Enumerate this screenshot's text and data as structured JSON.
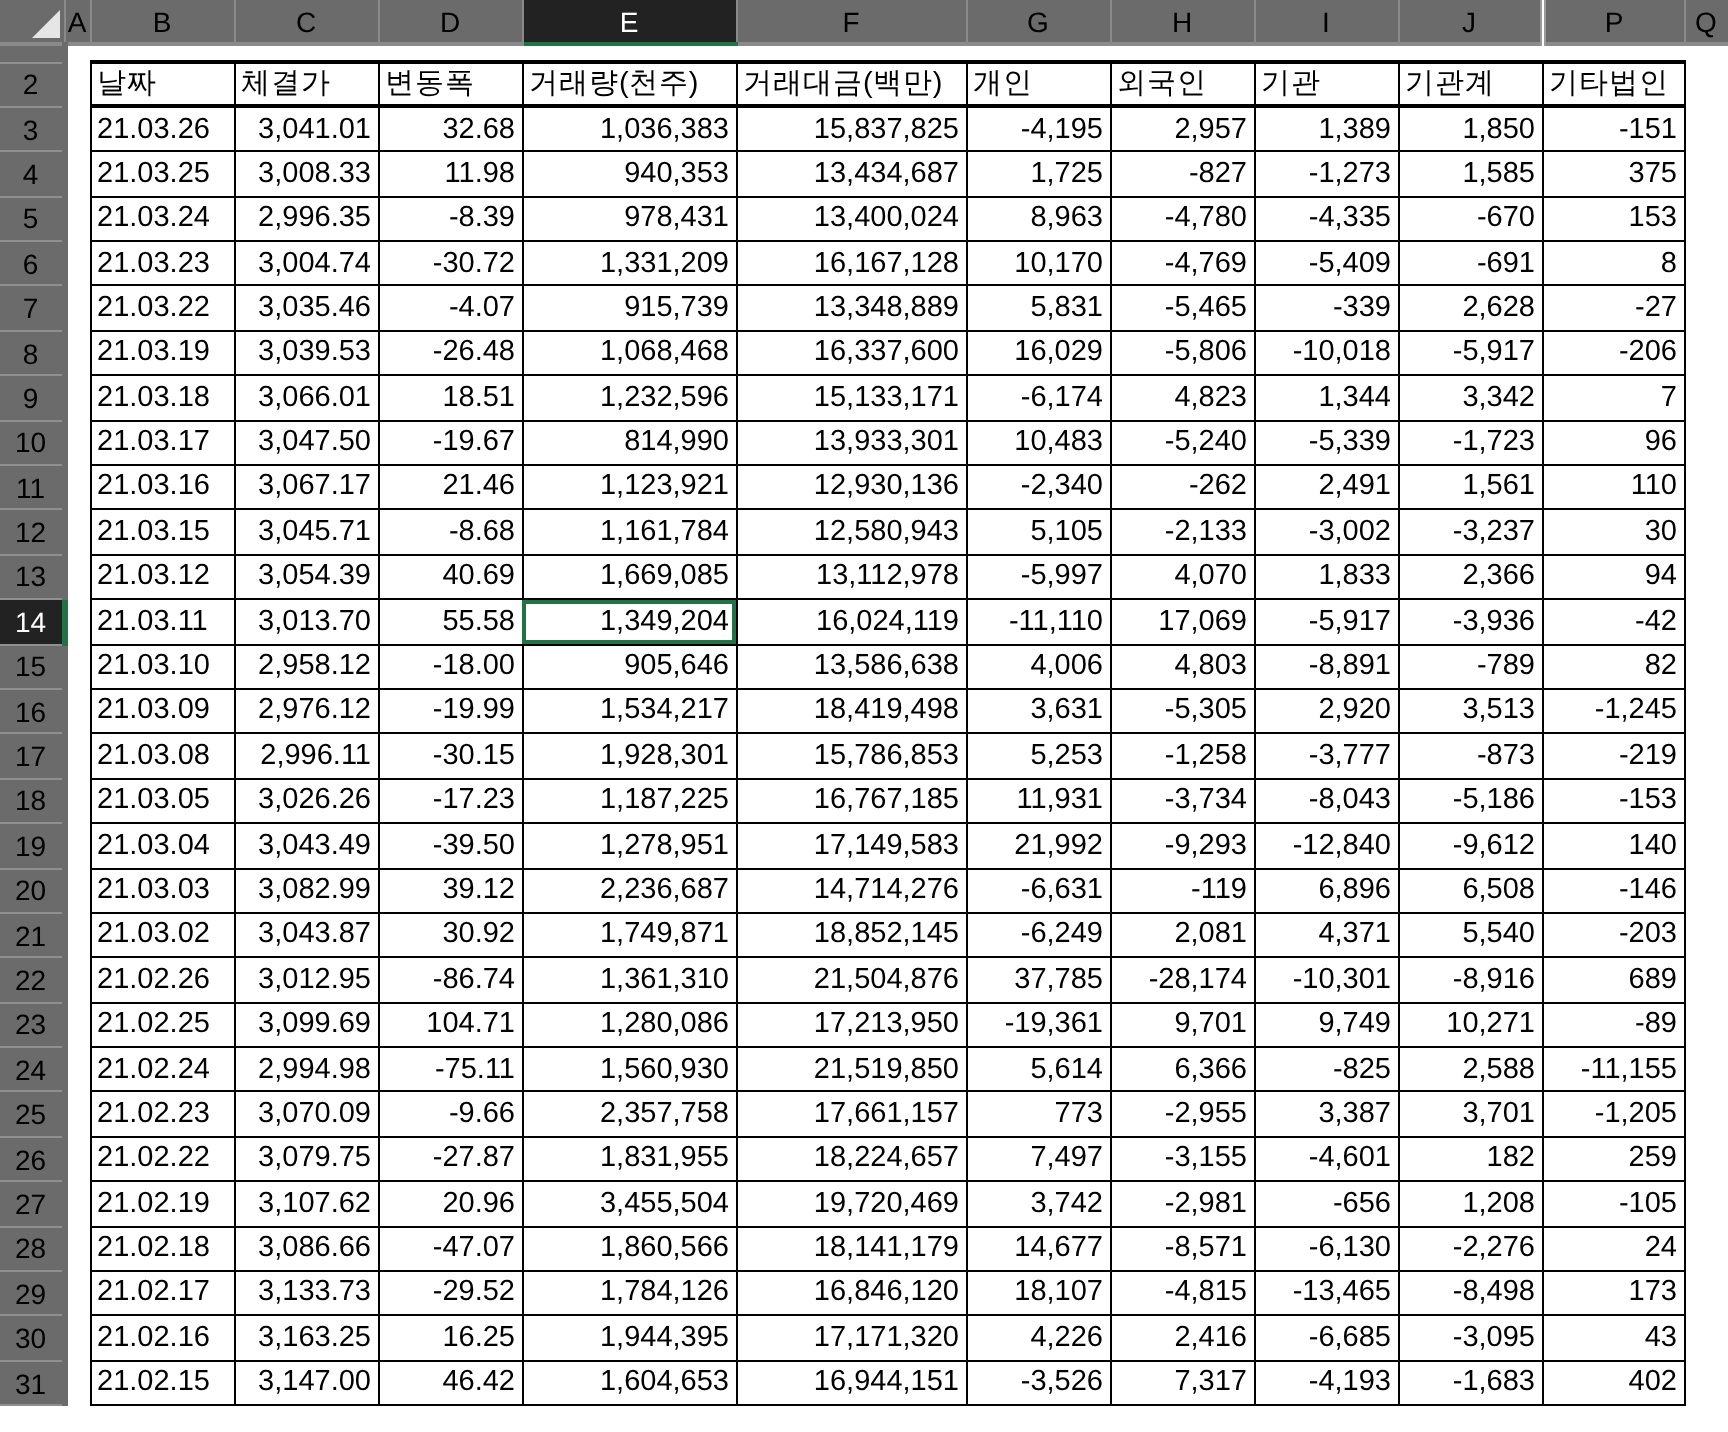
{
  "column_headers": [
    {
      "label": "A",
      "kind": "empty",
      "selected": false
    },
    {
      "label": "B",
      "kind": "data",
      "selected": false
    },
    {
      "label": "C",
      "kind": "data",
      "selected": false
    },
    {
      "label": "D",
      "kind": "data",
      "selected": false
    },
    {
      "label": "E",
      "kind": "data",
      "selected": true
    },
    {
      "label": "F",
      "kind": "data",
      "selected": false
    },
    {
      "label": "G",
      "kind": "data",
      "selected": false
    },
    {
      "label": "H",
      "kind": "data",
      "selected": false
    },
    {
      "label": "I",
      "kind": "data",
      "selected": false
    },
    {
      "label": "J",
      "kind": "data",
      "selected": false
    },
    {
      "label": "P",
      "kind": "data",
      "selected": false
    },
    {
      "label": "Q",
      "kind": "empty",
      "selected": false
    }
  ],
  "header_row": {
    "row_number": "2",
    "selected": false,
    "cells": [
      "날짜",
      "체결가",
      "변동폭",
      "거래량(천주)",
      "거래대금(백만)",
      "개인",
      "외국인",
      "기관",
      "기관계",
      "기타법인"
    ]
  },
  "rows": [
    {
      "row_number": "3",
      "selected": false,
      "cells": [
        "21.03.26",
        "3,041.01",
        "32.68",
        "1,036,383",
        "15,837,825",
        "-4,195",
        "2,957",
        "1,389",
        "1,850",
        "-151"
      ]
    },
    {
      "row_number": "4",
      "selected": false,
      "cells": [
        "21.03.25",
        "3,008.33",
        "11.98",
        "940,353",
        "13,434,687",
        "1,725",
        "-827",
        "-1,273",
        "1,585",
        "375"
      ]
    },
    {
      "row_number": "5",
      "selected": false,
      "cells": [
        "21.03.24",
        "2,996.35",
        "-8.39",
        "978,431",
        "13,400,024",
        "8,963",
        "-4,780",
        "-4,335",
        "-670",
        "153"
      ]
    },
    {
      "row_number": "6",
      "selected": false,
      "cells": [
        "21.03.23",
        "3,004.74",
        "-30.72",
        "1,331,209",
        "16,167,128",
        "10,170",
        "-4,769",
        "-5,409",
        "-691",
        "8"
      ]
    },
    {
      "row_number": "7",
      "selected": false,
      "cells": [
        "21.03.22",
        "3,035.46",
        "-4.07",
        "915,739",
        "13,348,889",
        "5,831",
        "-5,465",
        "-339",
        "2,628",
        "-27"
      ]
    },
    {
      "row_number": "8",
      "selected": false,
      "cells": [
        "21.03.19",
        "3,039.53",
        "-26.48",
        "1,068,468",
        "16,337,600",
        "16,029",
        "-5,806",
        "-10,018",
        "-5,917",
        "-206"
      ]
    },
    {
      "row_number": "9",
      "selected": false,
      "cells": [
        "21.03.18",
        "3,066.01",
        "18.51",
        "1,232,596",
        "15,133,171",
        "-6,174",
        "4,823",
        "1,344",
        "3,342",
        "7"
      ]
    },
    {
      "row_number": "10",
      "selected": false,
      "cells": [
        "21.03.17",
        "3,047.50",
        "-19.67",
        "814,990",
        "13,933,301",
        "10,483",
        "-5,240",
        "-5,339",
        "-1,723",
        "96"
      ]
    },
    {
      "row_number": "11",
      "selected": false,
      "cells": [
        "21.03.16",
        "3,067.17",
        "21.46",
        "1,123,921",
        "12,930,136",
        "-2,340",
        "-262",
        "2,491",
        "1,561",
        "110"
      ]
    },
    {
      "row_number": "12",
      "selected": false,
      "cells": [
        "21.03.15",
        "3,045.71",
        "-8.68",
        "1,161,784",
        "12,580,943",
        "5,105",
        "-2,133",
        "-3,002",
        "-3,237",
        "30"
      ]
    },
    {
      "row_number": "13",
      "selected": false,
      "cells": [
        "21.03.12",
        "3,054.39",
        "40.69",
        "1,669,085",
        "13,112,978",
        "-5,997",
        "4,070",
        "1,833",
        "2,366",
        "94"
      ]
    },
    {
      "row_number": "14",
      "selected": true,
      "cells": [
        "21.03.11",
        "3,013.70",
        "55.58",
        "1,349,204",
        "16,024,119",
        "-11,110",
        "17,069",
        "-5,917",
        "-3,936",
        "-42"
      ]
    },
    {
      "row_number": "15",
      "selected": false,
      "cells": [
        "21.03.10",
        "2,958.12",
        "-18.00",
        "905,646",
        "13,586,638",
        "4,006",
        "4,803",
        "-8,891",
        "-789",
        "82"
      ]
    },
    {
      "row_number": "16",
      "selected": false,
      "cells": [
        "21.03.09",
        "2,976.12",
        "-19.99",
        "1,534,217",
        "18,419,498",
        "3,631",
        "-5,305",
        "2,920",
        "3,513",
        "-1,245"
      ]
    },
    {
      "row_number": "17",
      "selected": false,
      "cells": [
        "21.03.08",
        "2,996.11",
        "-30.15",
        "1,928,301",
        "15,786,853",
        "5,253",
        "-1,258",
        "-3,777",
        "-873",
        "-219"
      ]
    },
    {
      "row_number": "18",
      "selected": false,
      "cells": [
        "21.03.05",
        "3,026.26",
        "-17.23",
        "1,187,225",
        "16,767,185",
        "11,931",
        "-3,734",
        "-8,043",
        "-5,186",
        "-153"
      ]
    },
    {
      "row_number": "19",
      "selected": false,
      "cells": [
        "21.03.04",
        "3,043.49",
        "-39.50",
        "1,278,951",
        "17,149,583",
        "21,992",
        "-9,293",
        "-12,840",
        "-9,612",
        "140"
      ]
    },
    {
      "row_number": "20",
      "selected": false,
      "cells": [
        "21.03.03",
        "3,082.99",
        "39.12",
        "2,236,687",
        "14,714,276",
        "-6,631",
        "-119",
        "6,896",
        "6,508",
        "-146"
      ]
    },
    {
      "row_number": "21",
      "selected": false,
      "cells": [
        "21.03.02",
        "3,043.87",
        "30.92",
        "1,749,871",
        "18,852,145",
        "-6,249",
        "2,081",
        "4,371",
        "5,540",
        "-203"
      ]
    },
    {
      "row_number": "22",
      "selected": false,
      "cells": [
        "21.02.26",
        "3,012.95",
        "-86.74",
        "1,361,310",
        "21,504,876",
        "37,785",
        "-28,174",
        "-10,301",
        "-8,916",
        "689"
      ]
    },
    {
      "row_number": "23",
      "selected": false,
      "cells": [
        "21.02.25",
        "3,099.69",
        "104.71",
        "1,280,086",
        "17,213,950",
        "-19,361",
        "9,701",
        "9,749",
        "10,271",
        "-89"
      ]
    },
    {
      "row_number": "24",
      "selected": false,
      "cells": [
        "21.02.24",
        "2,994.98",
        "-75.11",
        "1,560,930",
        "21,519,850",
        "5,614",
        "6,366",
        "-825",
        "2,588",
        "-11,155"
      ]
    },
    {
      "row_number": "25",
      "selected": false,
      "cells": [
        "21.02.23",
        "3,070.09",
        "-9.66",
        "2,357,758",
        "17,661,157",
        "773",
        "-2,955",
        "3,387",
        "3,701",
        "-1,205"
      ]
    },
    {
      "row_number": "26",
      "selected": false,
      "cells": [
        "21.02.22",
        "3,079.75",
        "-27.87",
        "1,831,955",
        "18,224,657",
        "7,497",
        "-3,155",
        "-4,601",
        "182",
        "259"
      ]
    },
    {
      "row_number": "27",
      "selected": false,
      "cells": [
        "21.02.19",
        "3,107.62",
        "20.96",
        "3,455,504",
        "19,720,469",
        "3,742",
        "-2,981",
        "-656",
        "1,208",
        "-105"
      ]
    },
    {
      "row_number": "28",
      "selected": false,
      "cells": [
        "21.02.18",
        "3,086.66",
        "-47.07",
        "1,860,566",
        "18,141,179",
        "14,677",
        "-8,571",
        "-6,130",
        "-2,276",
        "24"
      ]
    },
    {
      "row_number": "29",
      "selected": false,
      "cells": [
        "21.02.17",
        "3,133.73",
        "-29.52",
        "1,784,126",
        "16,846,120",
        "18,107",
        "-4,815",
        "-13,465",
        "-8,498",
        "173"
      ]
    },
    {
      "row_number": "30",
      "selected": false,
      "cells": [
        "21.02.16",
        "3,163.25",
        "16.25",
        "1,944,395",
        "17,171,320",
        "4,226",
        "2,416",
        "-6,685",
        "-3,095",
        "43"
      ]
    },
    {
      "row_number": "31",
      "selected": false,
      "cells": [
        "21.02.15",
        "3,147.00",
        "46.42",
        "1,604,653",
        "16,944,151",
        "-3,526",
        "7,317",
        "-4,193",
        "-1,683",
        "402"
      ]
    }
  ]
}
